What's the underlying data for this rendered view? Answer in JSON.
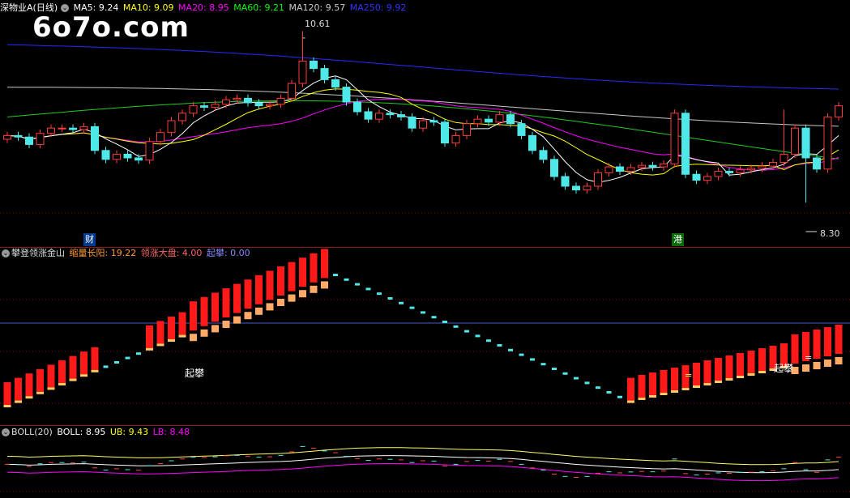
{
  "watermark": "6o7o.com",
  "main_panel": {
    "title": "深物业A(日线)",
    "indicators": [
      {
        "label": "MA5: 9.24",
        "color": "#ffffff"
      },
      {
        "label": "MA10: 9.09",
        "color": "#ffff00"
      },
      {
        "label": "MA20: 8.95",
        "color": "#ff00ff"
      },
      {
        "label": "MA60: 9.21",
        "color": "#00ff00"
      },
      {
        "label": "MA120: 9.57",
        "color": "#cccccc"
      },
      {
        "label": "MA250: 9.92",
        "color": "#3333ff"
      }
    ],
    "high_label": "10.61",
    "low_label": "8.30",
    "markers": {
      "cai": "财",
      "gang": "港"
    }
  },
  "sub_panel": {
    "title": "攀登领涨金山",
    "indicators": [
      {
        "label": "缩量长阳: 19.22",
        "color": "#ff9933"
      },
      {
        "label": "领涨大盘: 4.00",
        "color": "#ff6666"
      },
      {
        "label": "起攀: 0.00",
        "color": "#8888ff"
      }
    ],
    "signal_label": "起攀",
    "eq_label": "="
  },
  "boll_panel": {
    "title": "BOLL(20)",
    "indicators": [
      {
        "label": "BOLL: 8.95",
        "color": "#ffffff"
      },
      {
        "label": "UB: 9.43",
        "color": "#ffff00"
      },
      {
        "label": "LB: 8.48",
        "color": "#ff00ff"
      }
    ]
  },
  "chart_data": {
    "type": "candlestick",
    "price_range": [
      8.2,
      10.8
    ],
    "close_prices": [
      9.3,
      9.28,
      9.18,
      9.33,
      9.4,
      9.4,
      9.38,
      9.42,
      9.1,
      8.98,
      9.05,
      9.0,
      8.97,
      9.22,
      9.34,
      9.5,
      9.6,
      9.7,
      9.68,
      9.72,
      9.78,
      9.8,
      9.74,
      9.7,
      9.72,
      9.8,
      10.0,
      10.3,
      10.2,
      10.05,
      9.95,
      9.75,
      9.62,
      9.52,
      9.6,
      9.58,
      9.55,
      9.4,
      9.5,
      9.48,
      9.2,
      9.3,
      9.46,
      9.52,
      9.48,
      9.58,
      9.46,
      9.3,
      9.1,
      8.98,
      8.75,
      8.62,
      8.57,
      8.62,
      8.8,
      8.88,
      8.82,
      8.87,
      8.9,
      8.88,
      8.92,
      9.6,
      8.78,
      8.7,
      8.75,
      8.82,
      8.8,
      8.84,
      8.86,
      8.89,
      8.94,
      9.05,
      9.4,
      9.0,
      8.85,
      9.55,
      9.7
    ]
  }
}
